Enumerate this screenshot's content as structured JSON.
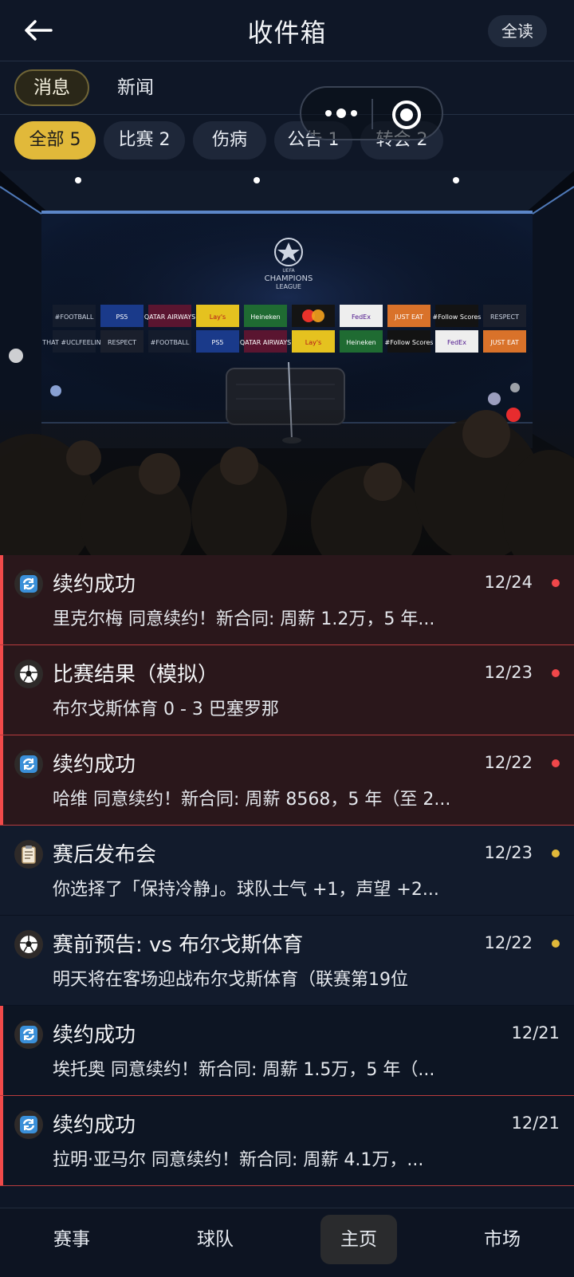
{
  "header": {
    "title": "收件箱",
    "read_all": "全读",
    "back_icon": "arrow-left-icon"
  },
  "tabs": [
    {
      "label": "消息",
      "active": true
    },
    {
      "label": "新闻",
      "active": false
    }
  ],
  "filters": [
    {
      "label": "全部 5",
      "selected": true
    },
    {
      "label": "比赛 2",
      "selected": false
    },
    {
      "label": "伤病",
      "selected": false
    },
    {
      "label": "公告 1",
      "selected": false
    },
    {
      "label": "转会 2",
      "selected": false
    }
  ],
  "capsule": {
    "more_icon": "more-dots-icon",
    "close_icon": "target-circle-icon"
  },
  "hero": {
    "competition": "UEFA CHAMPIONS LEAGUE",
    "competition_lines": [
      "UEFA",
      "CHAMPIONS",
      "LEAGUE"
    ],
    "sponsors_row1": [
      "#FOOTBALL",
      "PS5",
      "QATAR AIRWAYS",
      "Lay's",
      "Heineken",
      "mastercard",
      "FedEx",
      "JUST EAT",
      "#Follow Scores",
      "RESPECT"
    ],
    "sponsors_row2": [
      "THAT #UCLFEELING",
      "RESPECT",
      "#FOOTBALL",
      "PS5",
      "QATAR AIRWAYS",
      "Lay's",
      "Heineken",
      "#Follow Scores",
      "FedEx",
      "JUST EAT"
    ]
  },
  "messages": [
    {
      "icon": "refresh-icon",
      "title": "续约成功",
      "body": "里克尔梅 同意续约！新合同: 周薪 1.2万，5 年...",
      "date": "12/24",
      "dot": "#f0474a",
      "unread": true
    },
    {
      "icon": "soccer-ball-icon",
      "title": "比赛结果（模拟）",
      "body": "布尔戈斯体育 0 - 3 巴塞罗那",
      "date": "12/23",
      "dot": "#f0474a",
      "unread": true
    },
    {
      "icon": "refresh-icon",
      "title": "续约成功",
      "body": "哈维 同意续约！新合同: 周薪 8568，5 年（至 2...",
      "date": "12/22",
      "dot": "#f0474a",
      "unread": true
    },
    {
      "icon": "clipboard-icon",
      "title": "赛后发布会",
      "body": "你选择了「保持冷静」。球队士气 +1，声望 +2...",
      "date": "12/23",
      "dot": "#e1b93a",
      "unread": false
    },
    {
      "icon": "soccer-ball-icon",
      "title": "赛前预告: vs 布尔戈斯体育",
      "body": "明天将在客场迎战布尔戈斯体育（联赛第19位",
      "date": "12/22",
      "dot": "#e1b93a",
      "unread": false
    },
    {
      "icon": "refresh-icon",
      "title": "续约成功",
      "body": "埃托奥 同意续约！新合同: 周薪 1.5万，5 年（...",
      "date": "12/21",
      "dot": null,
      "unread": false
    },
    {
      "icon": "refresh-icon",
      "title": "续约成功",
      "body": "拉明·亚马尔 同意续约！新合同: 周薪 4.1万，...",
      "date": "12/21",
      "dot": null,
      "unread": false
    }
  ],
  "bottom_nav": [
    {
      "label": "赛事",
      "active": false
    },
    {
      "label": "球队",
      "active": false
    },
    {
      "label": "主页",
      "active": true
    },
    {
      "label": "市场",
      "active": false
    }
  ]
}
